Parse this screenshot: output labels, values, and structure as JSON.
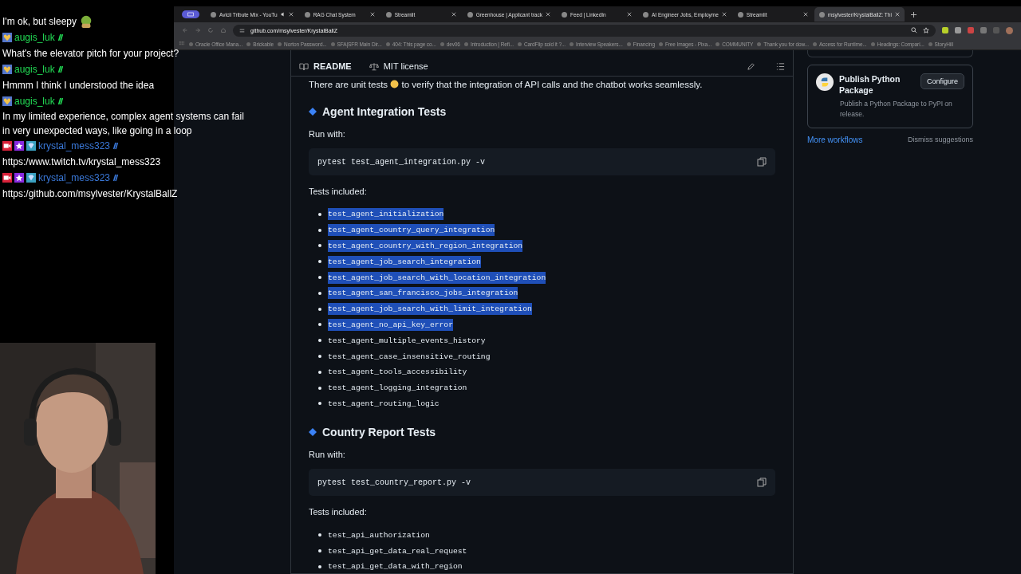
{
  "chat": [
    {
      "kind": "text",
      "text": "I'm ok, but sleepy"
    },
    {
      "kind": "user",
      "user": "augis_luk",
      "color": "#22dd55",
      "badges": [
        {
          "kind": "heart"
        }
      ]
    },
    {
      "kind": "text",
      "text": "What's the elevator pitch for your project?"
    },
    {
      "kind": "user",
      "user": "augis_luk",
      "color": "#22dd55",
      "badges": [
        {
          "kind": "heart"
        }
      ]
    },
    {
      "kind": "text",
      "text": "Hmmm I think I understood the idea"
    },
    {
      "kind": "user",
      "user": "augis_luk",
      "color": "#22dd55",
      "badges": [
        {
          "kind": "heart"
        }
      ]
    },
    {
      "kind": "text",
      "text": "In my limited experience, complex agent systems can fail in very unexpected ways, like going in a loop"
    },
    {
      "kind": "user",
      "user": "krystal_mess323",
      "color": "#3a78d8",
      "badges": [
        {
          "kind": "camera"
        },
        {
          "kind": "star"
        },
        {
          "kind": "gem"
        }
      ]
    },
    {
      "kind": "text",
      "text": "https:/www.twitch.tv/krystal_mess323"
    },
    {
      "kind": "user",
      "user": "krystal_mess323",
      "color": "#3a78d8",
      "badges": [
        {
          "kind": "camera"
        },
        {
          "kind": "star"
        },
        {
          "kind": "gem"
        }
      ]
    },
    {
      "kind": "text",
      "text": "https:/github.com/msylvester/KrystalBallZ"
    }
  ],
  "browser": {
    "tabs": [
      {
        "title": "Avicii Tribute Mix - YouTu",
        "selected": false,
        "audio": true
      },
      {
        "title": "RAG Chat System",
        "selected": false,
        "audio": false
      },
      {
        "title": "Streamlit",
        "selected": false,
        "audio": false
      },
      {
        "title": "Greenhouse | Applicant track",
        "selected": false,
        "audio": false
      },
      {
        "title": "Feed | LinkedIn",
        "selected": false,
        "audio": false
      },
      {
        "title": "AI Engineer Jobs, Employme",
        "selected": false,
        "audio": false
      },
      {
        "title": "Streamlit",
        "selected": false,
        "audio": false
      },
      {
        "title": "msylvester/KrystalBallZ: Thi",
        "selected": true,
        "audio": false
      }
    ],
    "address": "github.com/msylvester/KrystalBallZ",
    "bookmarks": [
      "Oracle Office Mana...",
      "Brickable",
      "Norton Password...",
      "SFA|SFR Main Dir...",
      "404: This page co...",
      "dev06",
      "Introduction | Refi...",
      "CardFlip sold it ?...",
      "Interview Speakers...",
      "Financing",
      "Free Images - Pixa...",
      "COMMUNITY",
      "Thank you for dow...",
      "Access for Runtime...",
      "Headings: Compari...",
      "StoryHill"
    ]
  },
  "readme": {
    "tabs": [
      {
        "label": "README",
        "selected": true
      },
      {
        "label": "MIT license",
        "selected": false
      }
    ],
    "intro": "There are unit tests",
    "intro_rest": "to verify that the integration of API calls and the chatbot works seamlessly.",
    "sections": [
      {
        "heading": "Agent Integration Tests",
        "run_label": "Run with:",
        "command": "pytest test_agent_integration.py -v",
        "included_label": "Tests included:",
        "tests": [
          {
            "name": "test_agent_initialization",
            "selected": true
          },
          {
            "name": "test_agent_country_query_integration",
            "selected": true
          },
          {
            "name": "test_agent_country_with_region_integration",
            "selected": true
          },
          {
            "name": "test_agent_job_search_integration",
            "selected": true
          },
          {
            "name": "test_agent_job_search_with_location_integration",
            "selected": true
          },
          {
            "name": "test_agent_san_francisco_jobs_integration",
            "selected": true
          },
          {
            "name": "test_agent_job_search_with_limit_integration",
            "selected": true
          },
          {
            "name": "test_agent_no_api_key_error",
            "selected": true
          },
          {
            "name": "test_agent_multiple_events_history",
            "selected": false
          },
          {
            "name": "test_agent_case_insensitive_routing",
            "selected": false
          },
          {
            "name": "test_agent_tools_accessibility",
            "selected": false
          },
          {
            "name": "test_agent_logging_integration",
            "selected": false
          },
          {
            "name": "test_agent_routing_logic",
            "selected": false
          }
        ]
      },
      {
        "heading": "Country Report Tests",
        "run_label": "Run with:",
        "command": "pytest test_country_report.py -v",
        "included_label": "Tests included:",
        "tests": [
          {
            "name": "test_api_authorization",
            "selected": false
          },
          {
            "name": "test_api_get_data_real_request",
            "selected": false
          },
          {
            "name": "test_api_get_data_with_region",
            "selected": false
          }
        ]
      }
    ]
  },
  "sidebar": {
    "card_title": "Publish Python Package",
    "card_text": "Publish a Python Package to PyPI on release.",
    "configure": "Configure",
    "more": "More workflows",
    "dismiss": "Dismiss suggestions"
  }
}
